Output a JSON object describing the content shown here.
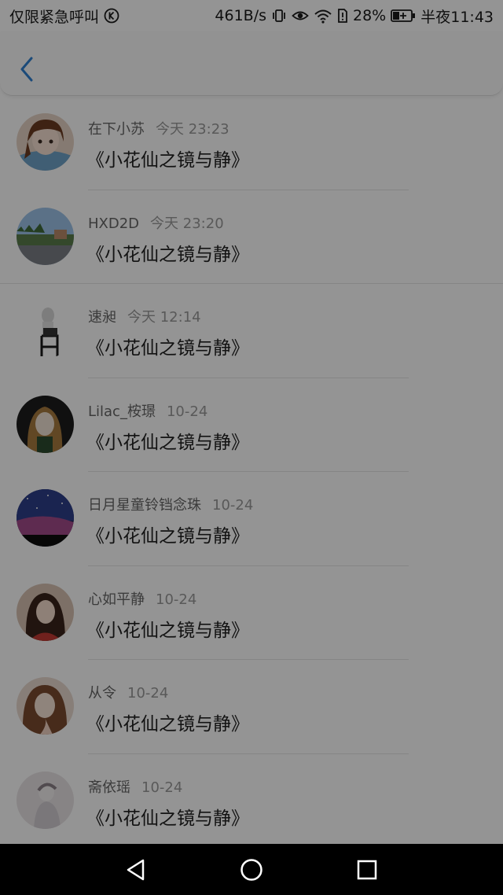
{
  "status_bar": {
    "left_text": "仅限紧急呼叫",
    "speed": "461B/s",
    "battery": "28%",
    "time": "半夜11:43"
  },
  "header": {
    "back_icon": "chevron-left-icon",
    "accent": "#2f80d0"
  },
  "items": [
    {
      "username": "在下小苏",
      "time": "今天 23:23",
      "title": "《小花仙之镜与静》",
      "avatar": "anime-girl"
    },
    {
      "username": "HXD2D",
      "time": "今天 23:20",
      "title": "《小花仙之镜与静》",
      "avatar": "landscape"
    },
    {
      "username": "速昶",
      "time": "今天 12:14",
      "title": "《小花仙之镜与静》",
      "avatar": "chair-sketch"
    },
    {
      "username": "Lilac_桉璟",
      "time": "10-24",
      "title": "《小花仙之镜与静》",
      "avatar": "dark-portrait"
    },
    {
      "username": "日月星童铃铛念珠",
      "time": "10-24",
      "title": "《小花仙之镜与静》",
      "avatar": "night-sky"
    },
    {
      "username": "心如平静",
      "time": "10-24",
      "title": "《小花仙之镜与静》",
      "avatar": "woman-red"
    },
    {
      "username": "从令",
      "time": "10-24",
      "title": "《小花仙之镜与静》",
      "avatar": "woman-portrait"
    },
    {
      "username": "斋依瑶",
      "time": "10-24",
      "title": "《小花仙之镜与静》",
      "avatar": "pale-figure"
    }
  ],
  "nav_bar": {
    "back": "triangle-back-icon",
    "home": "circle-home-icon",
    "recents": "square-recents-icon"
  }
}
